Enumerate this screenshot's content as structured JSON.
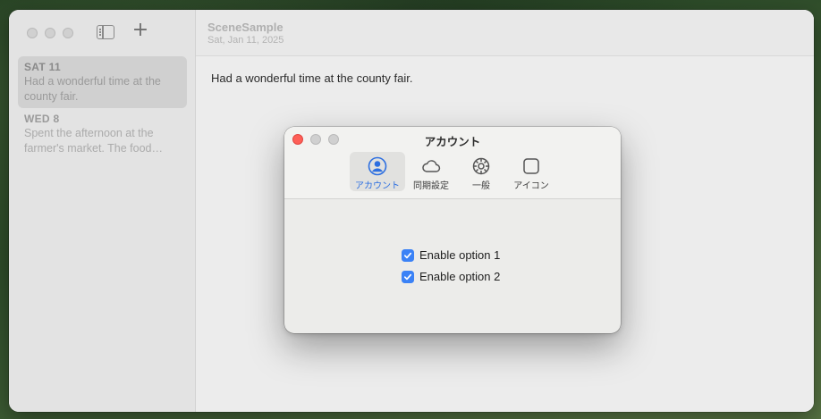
{
  "sidebar": {
    "new_entry_label": "+",
    "entries": [
      {
        "date": "SAT  11",
        "text": "Had a wonderful time at the county fair."
      },
      {
        "date": "WED  8",
        "text": "Spent the afternoon at the farmer's market. The food…"
      }
    ]
  },
  "header": {
    "title": "SceneSample",
    "subtitle": "Sat, Jan 11, 2025"
  },
  "main": {
    "body": "Had a wonderful time at the county fair."
  },
  "dialog": {
    "title": "アカウント",
    "tabs": [
      {
        "label": "アカウント",
        "icon": "person-circle-icon",
        "active": true
      },
      {
        "label": "同期設定",
        "icon": "cloud-icon",
        "active": false
      },
      {
        "label": "一般",
        "icon": "gear-icon",
        "active": false
      },
      {
        "label": "アイコン",
        "icon": "app-icon-square",
        "active": false
      }
    ],
    "options": [
      {
        "label": "Enable option 1",
        "checked": true
      },
      {
        "label": "Enable option 2",
        "checked": true
      }
    ]
  },
  "colors": {
    "accent": "#2d6fe0",
    "checkbox": "#3b82f6",
    "close_button": "#fe5f57"
  }
}
